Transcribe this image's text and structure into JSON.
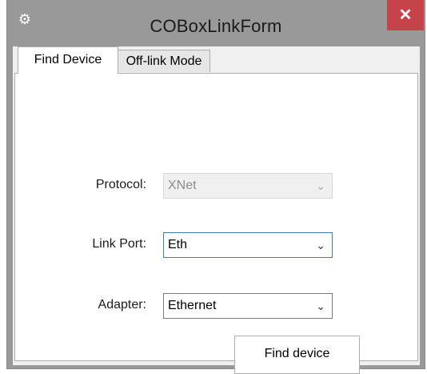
{
  "window": {
    "title": "COBoxLinkForm",
    "app_icon": "gear-icon",
    "close_glyph": "✕"
  },
  "tabs": [
    {
      "label": "Find Device",
      "active": true
    },
    {
      "label": "Off-link Mode",
      "active": false
    }
  ],
  "form": {
    "protocol": {
      "label": "Protocol:",
      "value": "XNet",
      "enabled": false
    },
    "link_port": {
      "label": "Link Port:",
      "value": "Eth",
      "enabled": true
    },
    "adapter": {
      "label": "Adapter:",
      "value": "Ethernet",
      "enabled": true
    },
    "find_button_label": "Find device"
  },
  "colors": {
    "titlebar": "#999999",
    "close_button": "#c7434a",
    "focus_border": "#3c7fb1"
  },
  "icons": {
    "chevron": "chevron-down-icon"
  }
}
